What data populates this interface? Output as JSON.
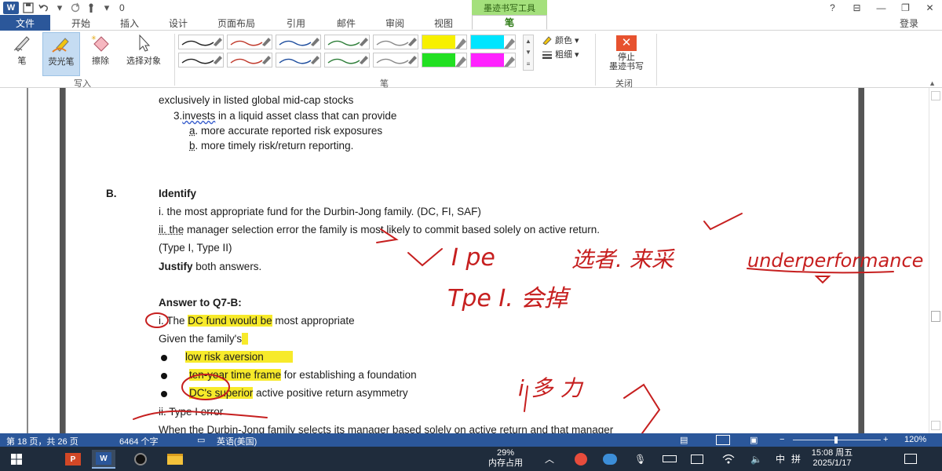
{
  "titlebar": {
    "app_icon": "W",
    "quick_access_number": "0",
    "contextual_title": "墨迹书写工具",
    "help": "?",
    "controls": [
      "⊟",
      "—",
      "❐",
      "✕"
    ]
  },
  "tabs": {
    "file": "文件",
    "home": "开始",
    "insert": "插入",
    "design": "设计",
    "layout": "页面布局",
    "references": "引用",
    "mailings": "邮件",
    "review": "审阅",
    "view": "视图",
    "pen": "笔",
    "login": "登录"
  },
  "ribbon": {
    "pen_button": "笔",
    "highlighter_button": "荧光笔",
    "eraser_button": "擦除",
    "select_button": "选择对象",
    "group_write": "写入",
    "group_pens": "笔",
    "color_label": "颜色",
    "thickness_label": "粗细",
    "stop_label_1": "停止",
    "stop_label_2": "墨迹书写",
    "group_close": "关闭",
    "pens": [
      {
        "color": "#222222",
        "style": "pen"
      },
      {
        "color": "#c0392b",
        "style": "pen"
      },
      {
        "color": "#1f4e9e",
        "style": "pen"
      },
      {
        "color": "#2f7f3a",
        "style": "pen"
      },
      {
        "color": "#8a8a8a",
        "style": "pen"
      },
      {
        "color": "#f7f000",
        "style": "highlighter"
      },
      {
        "color": "#00e5ff",
        "style": "highlighter"
      },
      {
        "color": "#222222",
        "style": "pen"
      },
      {
        "color": "#c0392b",
        "style": "pen"
      },
      {
        "color": "#1f4e9e",
        "style": "pen"
      },
      {
        "color": "#2f7f3a",
        "style": "pen"
      },
      {
        "color": "#8a8a8a",
        "style": "pen"
      },
      {
        "color": "#22e022",
        "style": "highlighter"
      },
      {
        "color": "#ff22ff",
        "style": "highlighter"
      }
    ]
  },
  "document": {
    "line1": "exclusively in listed global mid-cap stocks",
    "line2_prefix": "3.",
    "line2_word": "invests",
    "line2_rest": " in a liquid asset class that can provide",
    "line3_letter": "a",
    "line3_rest": ". more accurate reported risk exposures",
    "line4_letter": "b",
    "line4_rest": ". more timely risk/return reporting.",
    "section_label": "B.",
    "identify": "Identify",
    "item_i": "i. the most appropriate fund for the Durbin-Jong family. (DC, FI, SAF)",
    "item_ii_word": "ii. the",
    "item_ii_rest": " manager selection error the family is most likely to commit based solely on active return.",
    "item_type": "(Type I, Type II)",
    "justify_bold": "Justify",
    "justify_rest": " both answers.",
    "answer_heading": "Answer to Q7-B:",
    "answer_i_pre": "i. The ",
    "answer_i_hl": "DC fund would be",
    "answer_i_post": " most appropriate",
    "given": "Given the family's",
    "bullet1": "low risk aversion",
    "bullet2_hl": "ten-year time frame",
    "bullet2_rest": " for establishing a foundation",
    "bullet3_hl": "DC's superior",
    "bullet3_rest": " active positive return asymmetry",
    "answer_ii": "ii. Type I error",
    "last_line": "When the Durbin-Jong family selects its manager based solely on active return and that manager"
  },
  "ink": {
    "color": "#c61f1f",
    "annotation_1": "I pe",
    "annotation_2": "选者. 来采",
    "annotation_3": "underperformance",
    "annotation_4": "Tpe I. 会掉",
    "annotation_5": "i 多 力"
  },
  "statusbar": {
    "page": "第 18 页，共 26 页",
    "words": "6464 个字",
    "language": "英语(美国)",
    "zoom_minus": "−",
    "zoom_plus": "+",
    "zoom": "120%"
  },
  "taskbar": {
    "memory_percent": "29%",
    "memory_label": "内存占用",
    "ime_lang": "中",
    "ime_mode": "拼",
    "time": "15:08 周五",
    "date": "2025/1/17"
  }
}
